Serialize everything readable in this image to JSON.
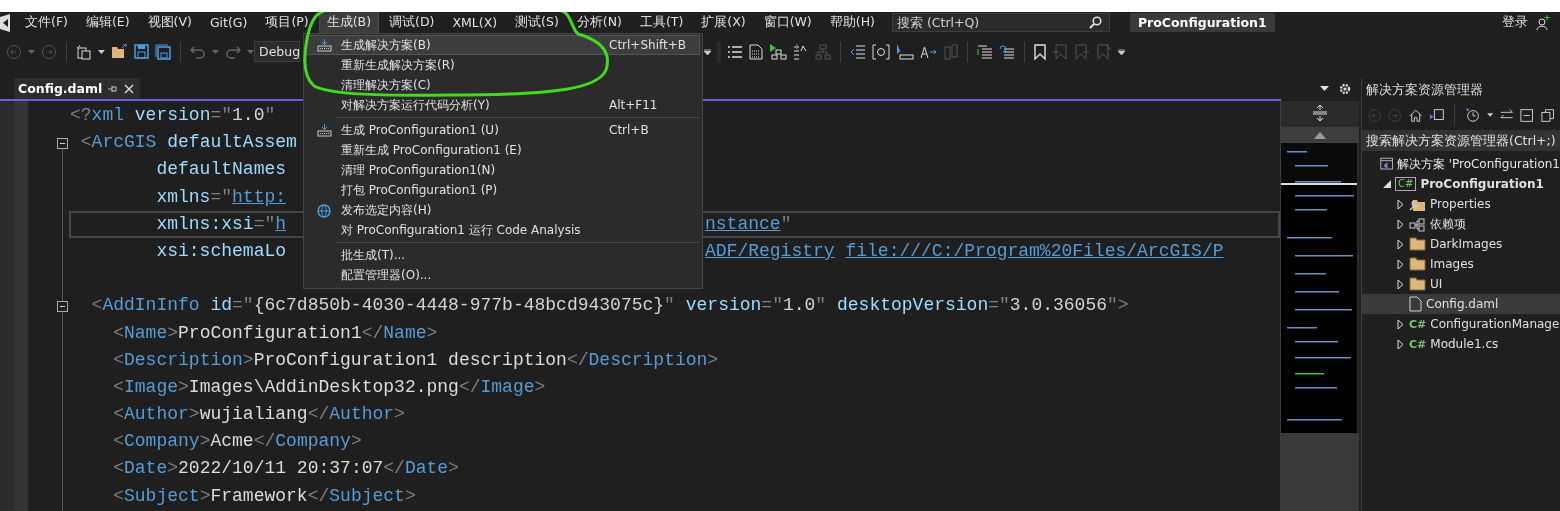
{
  "menu_bar": {
    "items": [
      {
        "label": "文件(F)",
        "selected": false
      },
      {
        "label": "编辑(E)",
        "selected": false
      },
      {
        "label": "视图(V)",
        "selected": false
      },
      {
        "label": "Git(G)",
        "selected": false
      },
      {
        "label": "项目(P)",
        "selected": false
      },
      {
        "label": "生成(B)",
        "selected": true
      },
      {
        "label": "调试(D)",
        "selected": false
      },
      {
        "label": "XML(X)",
        "selected": false
      },
      {
        "label": "测试(S)",
        "selected": false
      },
      {
        "label": "分析(N)",
        "selected": false
      },
      {
        "label": "工具(T)",
        "selected": false
      },
      {
        "label": "扩展(X)",
        "selected": false
      },
      {
        "label": "窗口(W)",
        "selected": false
      },
      {
        "label": "帮助(H)",
        "selected": false
      }
    ]
  },
  "search": {
    "placeholder": "搜索 (Ctrl+Q)"
  },
  "title": "ProConfiguration1",
  "sign_in": "登录",
  "toolbar": {
    "configuration": "Debug"
  },
  "editor": {
    "tab": {
      "label": "Config.daml",
      "selected": true
    },
    "lines": [
      {
        "kind": "code",
        "current": false,
        "fold": false,
        "left": [
          {
            "kind": "punct",
            "text": "<?"
          },
          {
            "kind": "tag",
            "text": "xml"
          },
          {
            "kind": "attr",
            "text": " version"
          },
          {
            "kind": "punct",
            "text": "=\""
          },
          {
            "kind": "value",
            "text": "1.0"
          },
          {
            "kind": "punct",
            "text": "\""
          }
        ]
      },
      {
        "kind": "code",
        "current": false,
        "fold": true,
        "left": [
          {
            "kind": "punct",
            "text": " <"
          },
          {
            "kind": "tag",
            "text": "ArcGIS"
          },
          {
            "kind": "attr",
            "text": " defaultAssem"
          }
        ]
      },
      {
        "kind": "code",
        "current": false,
        "fold": false,
        "left": [
          {
            "kind": "attr",
            "text": "        defaultNames"
          }
        ]
      },
      {
        "kind": "code",
        "current": false,
        "fold": false,
        "left": [
          {
            "kind": "attr",
            "text": "        xmlns"
          },
          {
            "kind": "punct",
            "text": "=\""
          },
          {
            "kind": "link",
            "text": "http:"
          }
        ]
      },
      {
        "kind": "code",
        "current": true,
        "fold": false,
        "left": [
          {
            "kind": "attr",
            "text": "        xmlns:xsi"
          },
          {
            "kind": "punct",
            "text": "=\""
          },
          {
            "kind": "link",
            "text": "h"
          }
        ],
        "right": [
          {
            "kind": "link",
            "text": "nstance"
          },
          {
            "kind": "punct",
            "text": "\""
          }
        ]
      },
      {
        "kind": "code",
        "current": false,
        "fold": false,
        "left": [
          {
            "kind": "attr",
            "text": "        xsi:schemaLo"
          }
        ],
        "right": [
          {
            "kind": "link",
            "text": "ADF/Registry"
          },
          {
            "kind": "link",
            "text": "file:///C:/Program%20Files/ArcGIS/P"
          }
        ]
      },
      {
        "kind": "blank"
      },
      {
        "kind": "code",
        "current": false,
        "fold": true,
        "left": [
          {
            "kind": "punct",
            "text": "  <"
          },
          {
            "kind": "tag",
            "text": "AddInInfo"
          },
          {
            "kind": "attr",
            "text": " id"
          },
          {
            "kind": "punct",
            "text": "=\""
          },
          {
            "kind": "value",
            "text": "{6c7d850b-4030-4448-977b-48bcd943075c}"
          },
          {
            "kind": "punct",
            "text": "\""
          },
          {
            "kind": "attr",
            "text": " version"
          },
          {
            "kind": "punct",
            "text": "=\""
          },
          {
            "kind": "value",
            "text": "1.0"
          },
          {
            "kind": "punct",
            "text": "\""
          },
          {
            "kind": "attr",
            "text": " desktopVersion"
          },
          {
            "kind": "punct",
            "text": "=\""
          },
          {
            "kind": "value",
            "text": "3.0.36056"
          },
          {
            "kind": "punct",
            "text": "\">"
          }
        ]
      },
      {
        "kind": "code",
        "current": false,
        "fold": false,
        "left": [
          {
            "kind": "punct",
            "text": "    <"
          },
          {
            "kind": "tag",
            "text": "Name"
          },
          {
            "kind": "punct",
            "text": ">"
          },
          {
            "kind": "text",
            "text": "ProConfiguration1"
          },
          {
            "kind": "punct",
            "text": "</"
          },
          {
            "kind": "tag",
            "text": "Name"
          },
          {
            "kind": "punct",
            "text": ">"
          }
        ]
      },
      {
        "kind": "code",
        "current": false,
        "fold": false,
        "left": [
          {
            "kind": "punct",
            "text": "    <"
          },
          {
            "kind": "tag",
            "text": "Description"
          },
          {
            "kind": "punct",
            "text": ">"
          },
          {
            "kind": "text",
            "text": "ProConfiguration1 description"
          },
          {
            "kind": "punct",
            "text": "</"
          },
          {
            "kind": "tag",
            "text": "Description"
          },
          {
            "kind": "punct",
            "text": ">"
          }
        ]
      },
      {
        "kind": "code",
        "current": false,
        "fold": false,
        "left": [
          {
            "kind": "punct",
            "text": "    <"
          },
          {
            "kind": "tag",
            "text": "Image"
          },
          {
            "kind": "punct",
            "text": ">"
          },
          {
            "kind": "text",
            "text": "Images\\AddinDesktop32.png"
          },
          {
            "kind": "punct",
            "text": "</"
          },
          {
            "kind": "tag",
            "text": "Image"
          },
          {
            "kind": "punct",
            "text": ">"
          }
        ]
      },
      {
        "kind": "code",
        "current": false,
        "fold": false,
        "left": [
          {
            "kind": "punct",
            "text": "    <"
          },
          {
            "kind": "tag",
            "text": "Author"
          },
          {
            "kind": "punct",
            "text": ">"
          },
          {
            "kind": "text",
            "text": "wujialiang"
          },
          {
            "kind": "punct",
            "text": "</"
          },
          {
            "kind": "tag",
            "text": "Author"
          },
          {
            "kind": "punct",
            "text": ">"
          }
        ]
      },
      {
        "kind": "code",
        "current": false,
        "fold": false,
        "left": [
          {
            "kind": "punct",
            "text": "    <"
          },
          {
            "kind": "tag",
            "text": "Company"
          },
          {
            "kind": "punct",
            "text": ">"
          },
          {
            "kind": "text",
            "text": "Acme"
          },
          {
            "kind": "punct",
            "text": "</"
          },
          {
            "kind": "tag",
            "text": "Company"
          },
          {
            "kind": "punct",
            "text": ">"
          }
        ]
      },
      {
        "kind": "code",
        "current": false,
        "fold": false,
        "left": [
          {
            "kind": "punct",
            "text": "    <"
          },
          {
            "kind": "tag",
            "text": "Date"
          },
          {
            "kind": "punct",
            "text": ">"
          },
          {
            "kind": "text",
            "text": "2022/10/11 20:37:07"
          },
          {
            "kind": "punct",
            "text": "</"
          },
          {
            "kind": "tag",
            "text": "Date"
          },
          {
            "kind": "punct",
            "text": ">"
          }
        ]
      },
      {
        "kind": "code",
        "current": false,
        "fold": false,
        "left": [
          {
            "kind": "punct",
            "text": "    <"
          },
          {
            "kind": "tag",
            "text": "Subject"
          },
          {
            "kind": "punct",
            "text": ">"
          },
          {
            "kind": "text",
            "text": "Framework"
          },
          {
            "kind": "punct",
            "text": "</"
          },
          {
            "kind": "tag",
            "text": "Subject"
          },
          {
            "kind": "punct",
            "text": ">"
          }
        ]
      }
    ]
  },
  "build_menu": {
    "items": [
      {
        "kind": "build-command",
        "label": "生成解决方案(B)",
        "shortcut": "Ctrl+Shift+B",
        "selected": true
      },
      {
        "kind": "command",
        "label": "重新生成解决方案(R)",
        "selected": false
      },
      {
        "kind": "command",
        "label": "清理解决方案(C)",
        "selected": false
      },
      {
        "kind": "command",
        "label": "对解决方案运行代码分析(Y)",
        "shortcut": "Alt+F11",
        "selected": false
      },
      {
        "kind": "separator"
      },
      {
        "kind": "build-command",
        "label": "生成 ProConfiguration1 (U)",
        "shortcut": "Ctrl+B",
        "selected": false
      },
      {
        "kind": "command",
        "label": "重新生成 ProConfiguration1 (E)",
        "selected": false
      },
      {
        "kind": "command",
        "label": "清理 ProConfiguration1(N)",
        "selected": false
      },
      {
        "kind": "command",
        "label": "打包 ProConfiguration1 (P)",
        "selected": false
      },
      {
        "kind": "publish-command",
        "label": "发布选定内容(H)",
        "selected": false
      },
      {
        "kind": "command",
        "label": "对 ProConfiguration1 运行 Code Analysis",
        "selected": false
      },
      {
        "kind": "separator"
      },
      {
        "kind": "command",
        "label": "批生成(T)...",
        "selected": false
      },
      {
        "kind": "command",
        "label": "配置管理器(O)...",
        "selected": false
      }
    ]
  },
  "solution_explorer": {
    "title": "解决方案资源管理器",
    "search": {
      "placeholder": "搜索解决方案资源管理器(Ctrl+;)"
    },
    "tree": [
      {
        "kind": "solution",
        "label": "解决方案 'ProConfiguration1",
        "selected": false,
        "children": [
          {
            "kind": "csharp-project",
            "badge": "C#",
            "label": "ProConfiguration1",
            "selected": false,
            "expanded": true,
            "children": [
              {
                "kind": "properties",
                "label": "Properties",
                "selected": false,
                "expanded": false
              },
              {
                "kind": "references",
                "label": "依赖项",
                "selected": false,
                "expanded": false
              },
              {
                "kind": "folder",
                "label": "DarkImages",
                "selected": false,
                "expanded": false
              },
              {
                "kind": "folder",
                "label": "Images",
                "selected": false,
                "expanded": false
              },
              {
                "kind": "folder",
                "label": "UI",
                "selected": false,
                "expanded": false
              },
              {
                "kind": "file",
                "label": "Config.daml",
                "selected": true
              },
              {
                "kind": "csharp-file",
                "badge": "C#",
                "label": "ConfigurationManage",
                "selected": false,
                "expanded": false
              },
              {
                "kind": "csharp-file",
                "badge": "C#",
                "label": "Module1.cs",
                "selected": false,
                "expanded": false
              }
            ]
          }
        ]
      }
    ]
  },
  "annotation": {
    "kind": "freehand-circle"
  }
}
